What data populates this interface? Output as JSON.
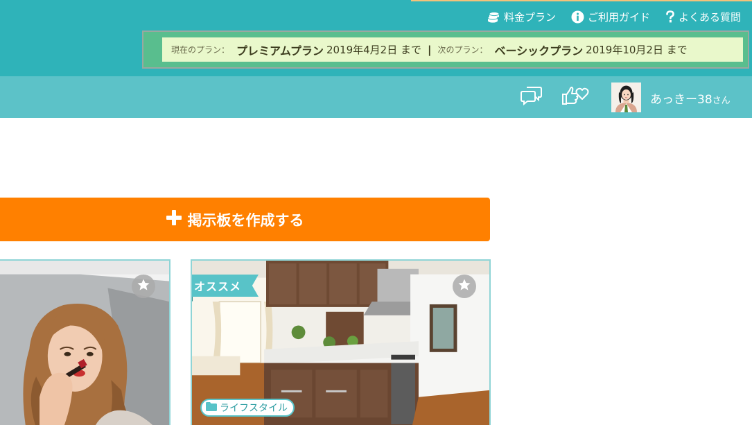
{
  "header": {
    "links": [
      {
        "label": "料金プラン",
        "icon": "coins-icon"
      },
      {
        "label": "ご利用ガイド",
        "icon": "info-icon"
      },
      {
        "label": "よくある質問",
        "icon": "question-icon"
      }
    ],
    "plan": {
      "current_label": "現在のプラン：",
      "current_name": "プレミアムプラン",
      "current_until": "2019年4月2日 まで",
      "separator": "|",
      "next_label": "次のプラン：",
      "next_name": "ベーシックプラン",
      "next_until": "2019年10月2日 まで"
    }
  },
  "userbar": {
    "icons": [
      "chat-bubbles-icon",
      "thumbs-up-heart-icon"
    ],
    "username": "あっきー38",
    "honorific": "さん"
  },
  "main": {
    "create_button": "掲示板を作成する",
    "cards": [
      {
        "image": "woman-applying-lipstick-photo",
        "favorite_icon": "star-icon"
      },
      {
        "image": "kitchen-interior-photo",
        "ribbon": "オススメ",
        "category": "ライフスタイル",
        "category_icon": "folder-icon",
        "favorite_icon": "star-icon"
      }
    ]
  },
  "colors": {
    "header_bg": "#2fb3b9",
    "userbar_bg": "#5cc2c8",
    "plan_box_bg": "#e9f8cb",
    "create_button_bg": "#ff8000",
    "accent_teal": "#58c3c8"
  }
}
